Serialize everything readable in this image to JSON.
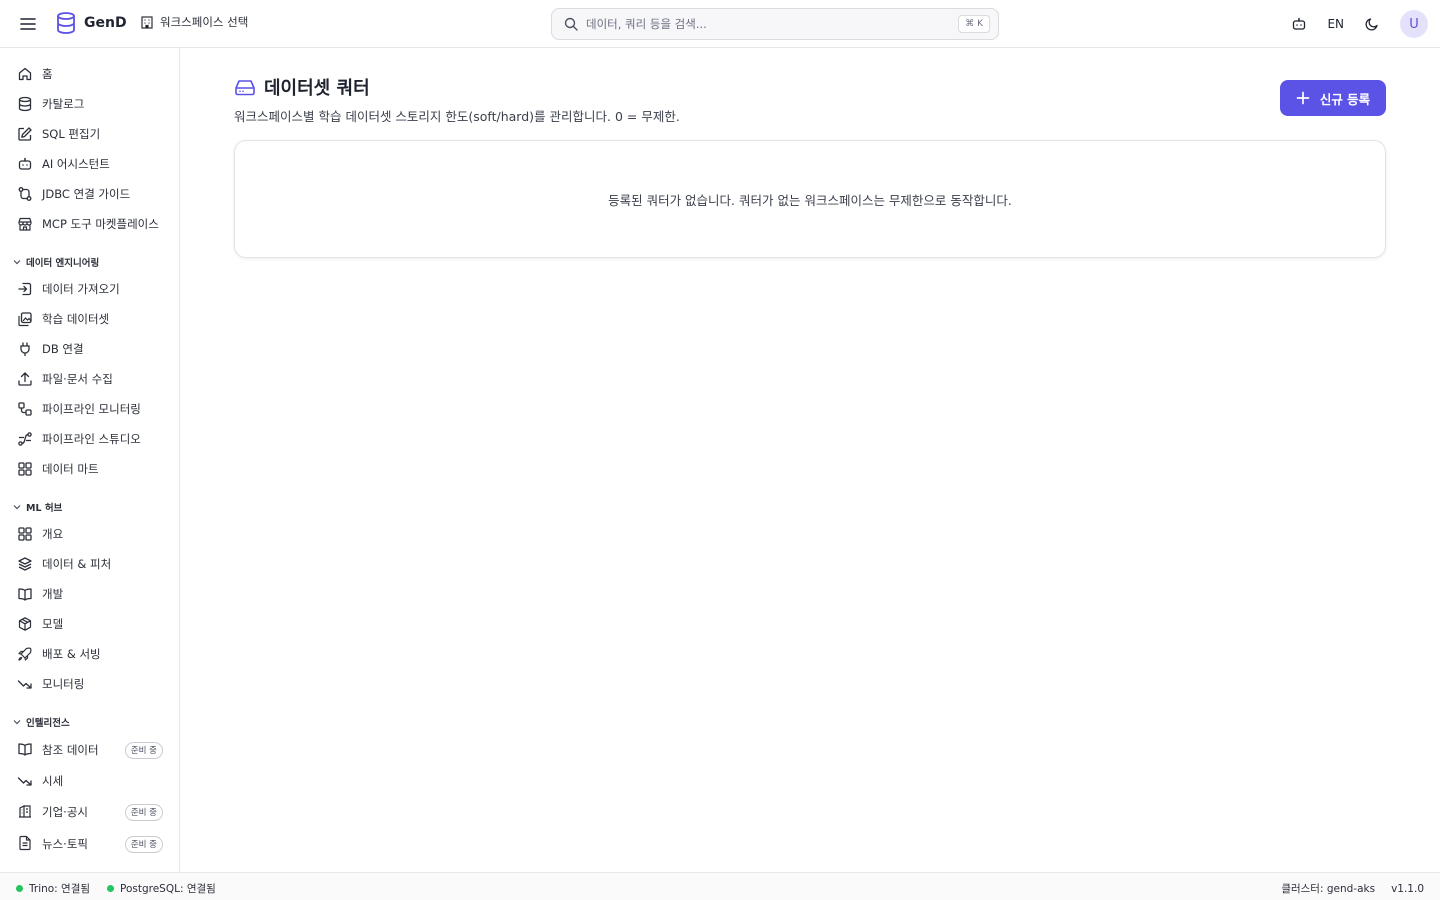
{
  "app": {
    "name": "GenD",
    "workspace_select": "워크스페이스 선택"
  },
  "search": {
    "placeholder": "데이터, 쿼리 등을 검색...",
    "shortcut": "⌘ K"
  },
  "header": {
    "lang": "EN",
    "avatar_initial": "U"
  },
  "sidebar": {
    "items": [
      {
        "label": "홈",
        "icon": "home-icon"
      },
      {
        "label": "카탈로그",
        "icon": "database-icon"
      },
      {
        "label": "SQL 편집기",
        "icon": "edit-icon"
      },
      {
        "label": "AI 어시스턴트",
        "icon": "bot-icon"
      },
      {
        "label": "JDBC 연결 가이드",
        "icon": "route-icon"
      },
      {
        "label": "MCP 도구 마켓플레이스",
        "icon": "store-icon"
      }
    ],
    "sections": [
      {
        "label": "데이터 엔지니어링",
        "items": [
          {
            "label": "데이터 가져오기",
            "icon": "import-icon"
          },
          {
            "label": "학습 데이터셋",
            "icon": "images-icon"
          },
          {
            "label": "DB 연결",
            "icon": "plug-icon"
          },
          {
            "label": "파일·문서 수집",
            "icon": "upload-icon"
          },
          {
            "label": "파이프라인 모니터링",
            "icon": "workflow-icon"
          },
          {
            "label": "파이프라인 스튜디오",
            "icon": "spline-icon"
          },
          {
            "label": "데이터 마트",
            "icon": "grid-icon"
          }
        ]
      },
      {
        "label": "ML 허브",
        "items": [
          {
            "label": "개요",
            "icon": "grid-icon"
          },
          {
            "label": "데이터 & 피처",
            "icon": "layers-icon"
          },
          {
            "label": "개발",
            "icon": "book-icon"
          },
          {
            "label": "모델",
            "icon": "box-icon"
          },
          {
            "label": "배포 & 서빙",
            "icon": "rocket-icon"
          },
          {
            "label": "모니터링",
            "icon": "trending-down-icon"
          }
        ]
      },
      {
        "label": "인텔리전스",
        "items": [
          {
            "label": "참조 데이터",
            "icon": "book-icon",
            "badge": "준비 중"
          },
          {
            "label": "시세",
            "icon": "trending-down-icon"
          },
          {
            "label": "기업·공시",
            "icon": "building-icon",
            "badge": "준비 중"
          },
          {
            "label": "뉴스·토픽",
            "icon": "file-text-icon",
            "badge": "준비 중"
          }
        ]
      }
    ]
  },
  "page": {
    "title": "데이터셋 쿼터",
    "description": "워크스페이스별 학습 데이터셋 스토리지 한도(soft/hard)를 관리합니다. 0 = 무제한.",
    "new_button": "신규 등록",
    "empty_message": "등록된 쿼터가 없습니다. 쿼터가 없는 워크스페이스는 무제한으로 동작합니다."
  },
  "status": {
    "trino": "Trino: 연결됨",
    "postgres": "PostgreSQL: 연결됨",
    "cluster": "클러스터: gend-aks",
    "version": "v1.1.0"
  },
  "colors": {
    "accent": "#5b52e6",
    "connected": "#22c55e"
  }
}
